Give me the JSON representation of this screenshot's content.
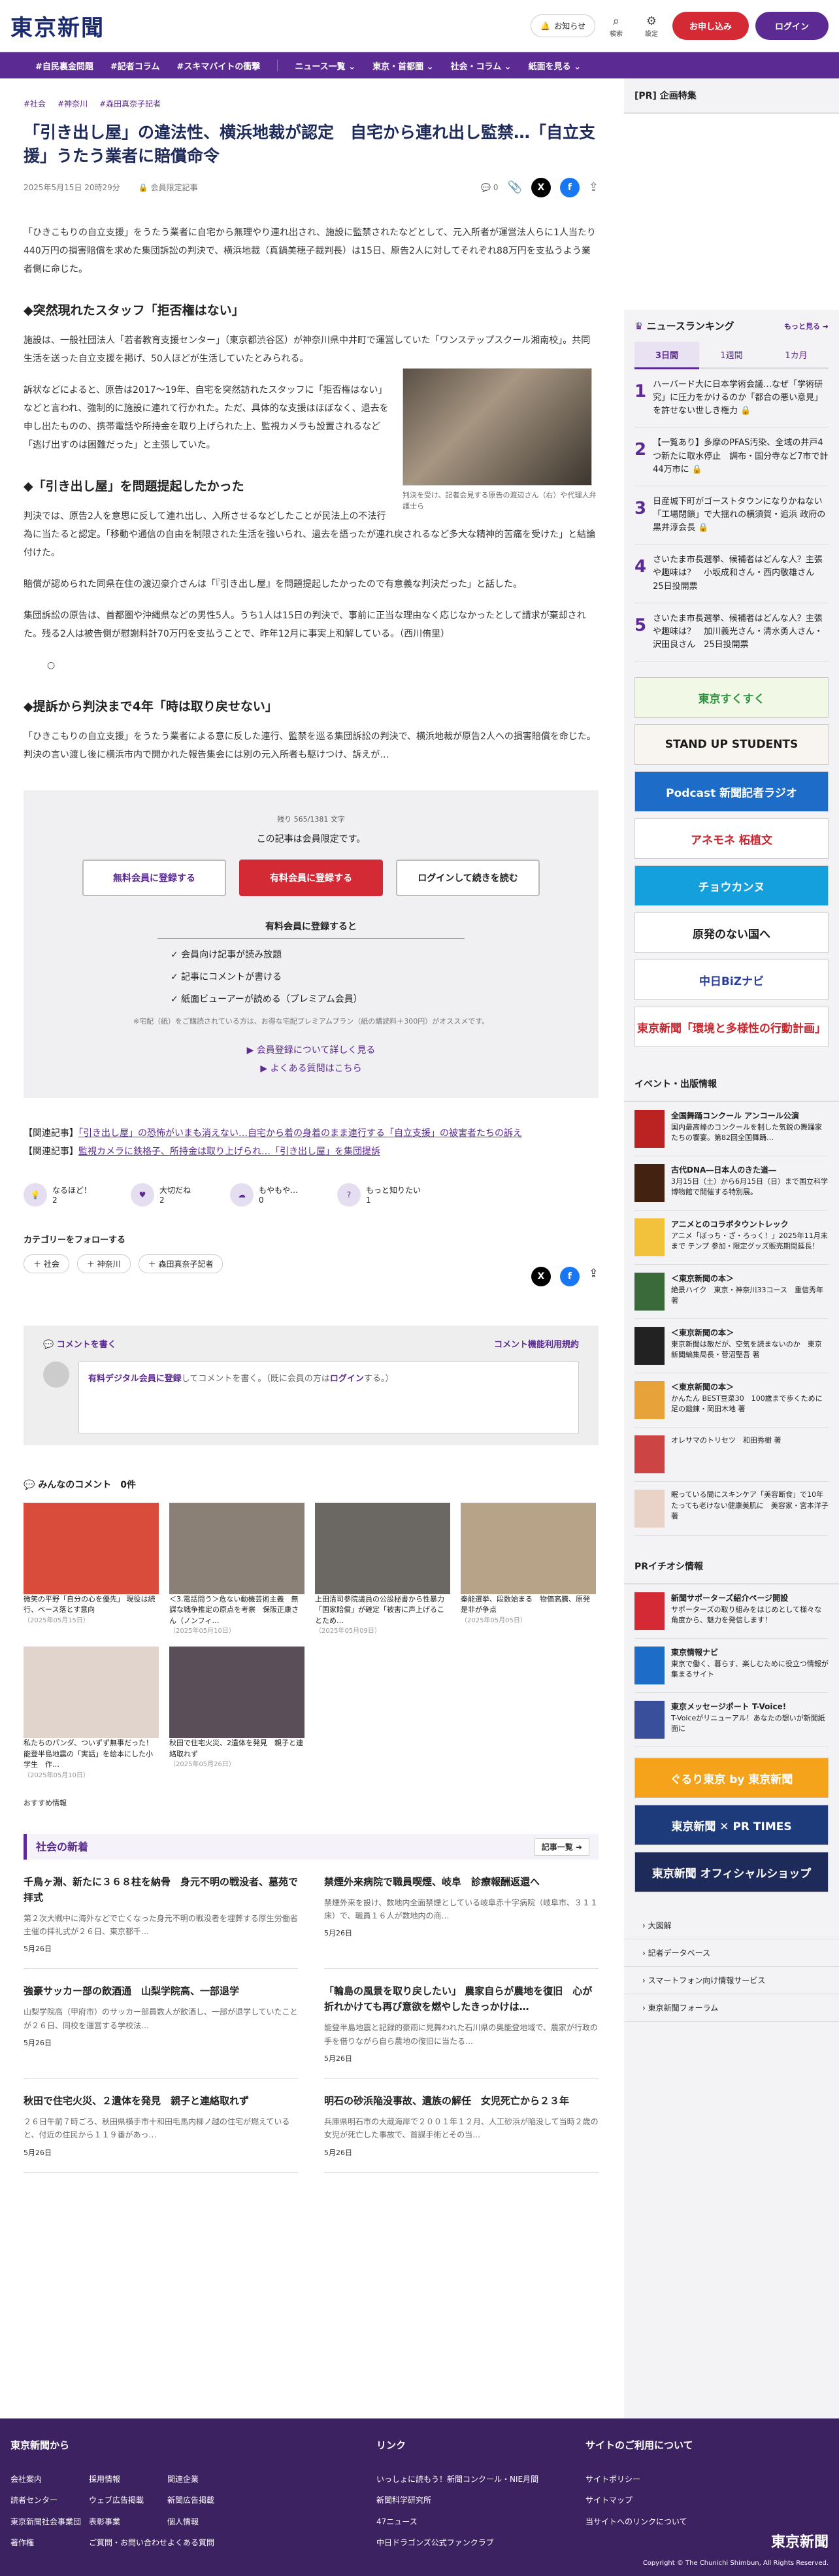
{
  "header": {
    "logo": "東京新聞",
    "notice": "お知らせ",
    "search": "検索",
    "settings": "設定",
    "register": "お申し込み",
    "login": "ログイン"
  },
  "nav": [
    "#自民裏金問題",
    "#記者コラム",
    "#スキマバイトの衝撃",
    "ニュース一覧 ⌄",
    "東京・首都圏 ⌄",
    "社会・コラム ⌄",
    "紙面を見る ⌄"
  ],
  "article": {
    "tags": [
      "#社会",
      "#神奈川",
      "#森田真奈子記者"
    ],
    "title": "「引き出し屋」の違法性、横浜地裁が認定　自宅から連れ出し監禁…「自立支援」うたう業者に賠償命令",
    "date": "2025年5月15日 20時29分",
    "member": "会員限定記事",
    "comment_count": "0",
    "p1": "「ひきこもりの自立支援」をうたう業者に自宅から無理やり連れ出され、施設に監禁されたなどとして、元入所者が運営法人らに1人当たり440万円の損害賠償を求めた集団訴訟の判決で、横浜地裁（真鍋美穂子裁判長）は15日、原告2人に対してそれぞれ88万円を支払うよう業者側に命じた。",
    "h1": "◆突然現れたスタッフ「拒否権はない」",
    "p2": "施設は、一般社団法人「若者教育支援センター」（東京都渋谷区）が神奈川県中井町で運営していた「ワンステップスクール湘南校」。共同生活を送った自立支援を掲げ、50人ほどが生活していたとみられる。",
    "p3": "訴状などによると、原告は2017～19年、自宅を突然訪れたスタッフに「拒否権はない」などと言われ、強制的に施設に連れて行かれた。ただ、具体的な支援はほぼなく、退去を申し出たものの、携帯電話や所持金を取り上げられた上、監視カメラも設置されるなど「逃げ出すのは困難だった」と主張していた。",
    "caption": "判決を受け、記者会見する原告の渡辺さん（右）や代理人弁護士ら",
    "h2": "◆「引き出し屋」を問題提起したかった",
    "p4": "判決では、原告2人を意思に反して連れ出し、入所させるなどしたことが民法上の不法行為に当たると認定。「移動や通信の自由を制限された生活を強いられ、過去を語ったが連れ戻されるなど多大な精神的苦痛を受けた」と結論付けた。",
    "p5": "賠償が認められた同県在住の渡辺豪介さんは「『引き出し屋』を問題提起したかったので有意義な判決だった」と話した。",
    "p6": "集団訴訟の原告は、首都圏や沖縄県などの男性5人。うち1人は15日の判決で、事前に正当な理由なく応じなかったとして請求が棄却された。残る2人は被告側が慰謝料計70万円を支払うことで、昨年12月に事実上和解している。（西川侑里）",
    "circle": "○",
    "h3": "◆提訴から判決まで4年「時は取り戻せない」",
    "p7": "「ひきこもりの自立支援」をうたう業者による意に反した連行、監禁を巡る集団訴訟の判決で、横浜地裁が原告2人への損害賠償を命じた。判決の言い渡し後に横浜市内で開かれた報告集会には別の元入所者も駆けつけ、訴えが…"
  },
  "paywall": {
    "remain": "残り 565/1381 文字",
    "msg": "この記事は会員限定です。",
    "free": "無料会員に登録する",
    "paid": "有料会員に登録する",
    "login": "ログインして続きを読む",
    "list_title": "有料会員に登録すると",
    "benefits": [
      "✓ 会員向け記事が読み放題",
      "✓ 記事にコメントが書ける",
      "✓ 紙面ビューアーが読める（プレミアム会員）"
    ],
    "note": "※宅配（紙）をご購読されている方は、お得な宅配プレミアムプラン（紙の購読料＋300円）がオススメです。",
    "link1": "▶ 会員登録について詳しく見る",
    "link2": "▶ よくある質問はこちら"
  },
  "related": {
    "label": "【関連記事】",
    "r1": "「引き出し屋」の恐怖がいまも消えない…自宅から着の身着のまま連行する「自立支援」の被害者たちの訴え",
    "r2": "監視カメラに鉄格子、所持金は取り上げられ…「引き出し屋」を集団提訴"
  },
  "reactions": [
    {
      "label": "なるほど！",
      "count": "2",
      "icon": "💡"
    },
    {
      "label": "大切だね",
      "count": "2",
      "icon": "♥"
    },
    {
      "label": "もやもや…",
      "count": "0",
      "icon": "☁"
    },
    {
      "label": "もっと知りたい",
      "count": "1",
      "icon": "?"
    }
  ],
  "follow": {
    "title": "カテゴリーをフォローする",
    "chips": [
      "＋ 社会",
      "＋ 神奈川",
      "＋ 森田真奈子記者"
    ]
  },
  "comment": {
    "write": "コメントを書く",
    "rules": "コメント機能利用規約",
    "placeholder_a": "有料デジタル会員に登録",
    "placeholder_b": "してコメントを書く。（既に会員の方は",
    "placeholder_c": "ログイン",
    "placeholder_d": "する。）",
    "all": "みんなのコメント　0件"
  },
  "cards": [
    {
      "t": "微笑の平野「自分の心を優先」 現役は続行、ベース落とす意向",
      "d": "（2025年05月15日）",
      "c": "#d94b3a"
    },
    {
      "t": "＜3.電話問う＞危ない動機芸術主義　無謀な戦争推定の原点を考察　保阪正康さん（ノンフィ…",
      "d": "（2025年05月10日）",
      "c": "#8a8076"
    },
    {
      "t": "上田清司参院議員の公設秘書から性暴力「国家賠償」が確定「被害に声上げることため…",
      "d": "（2025年05月09日）",
      "c": "#6b6762"
    },
    {
      "t": "秦能選挙、段数始まる　物価高騰、原発是非が争点",
      "d": "（2025年05月05日）",
      "c": "#b7a387"
    },
    {
      "t": "私たちのパンダ、ついずず無事だった！　能登半島地震の「実話」を絵本にした小学生　作…",
      "d": "（2025年05月10日）",
      "c": "#e0d4cc"
    },
    {
      "t": "秋田で住宅火災、2遺体を発見　親子と連絡取れず",
      "d": "（2025年05月26日）",
      "c": "#5a4e58"
    }
  ],
  "recommend": "おすすめ情報",
  "social": {
    "title": "社会の新着",
    "more": "記事一覧 ➜",
    "items": [
      {
        "h": "千鳥ヶ淵、新たに３６８柱を納骨　身元不明の戦没者、墓苑で拝式",
        "p": "第２次大戦中に海外などで亡くなった身元不明の戦没者を埋葬する厚生労働省主催の拝礼式が２６日、東京都千…",
        "d": "5月26日"
      },
      {
        "h": "禁煙外来病院で職員喫煙、岐阜　診療報酬返還へ",
        "p": "禁煙外来を設け、数地内全面禁煙としている岐阜赤十字病院（岐阜市、３１１床）で、職員１６人が数地内の商…",
        "d": "5月26日"
      },
      {
        "h": "強豪サッカー部の飲酒通　山梨学院高、一部退学",
        "p": "山梨学院高（甲府市）のサッカー部員数人が飲酒し、一部が退学していたことが２６日、同校を運営する学校法…",
        "d": "5月26日"
      },
      {
        "h": "「輪島の風景を取り戻したい」 農家自らが農地を復旧　心が折れかけても再び意欲を燃やしたきっかけは…",
        "p": "能登半島地震と記録的豪雨に見舞われた石川県の奥能登地域で、農家が行政の手を借りながら自ら農地の復旧に当たる…",
        "d": "5月26日"
      },
      {
        "h": "秋田で住宅火災、２遺体を発見　親子と連絡取れず",
        "p": "２６日午前７時ごろ、秋田県横手市十和田毛馬内柳ノ越の住宅が燃えていると、付近の住民から１１９番があっ…",
        "d": "5月26日"
      },
      {
        "h": "明石の砂浜陥没事故、遺族の解任　女児死亡から２３年",
        "p": "兵庫県明石市の大蔵海岸で２００１年１２月、人工砂浜が陥没して当時２歳の女児が死亡した事故で、首謀手術とその当…",
        "d": "5月26日"
      }
    ]
  },
  "side": {
    "pr": "[PR] 企画特集",
    "ranking": "ニュースランキング",
    "ranking_more": "もっと見る ➜",
    "tabs": [
      "3日間",
      "1週間",
      "1カ月"
    ],
    "ranks": [
      {
        "n": "1",
        "t": "ハーバード大に日本学術会議…なぜ「学術研究」に圧力をかけるのか「都合の悪い意見」を許せない世しき権力 🔒"
      },
      {
        "n": "2",
        "t": "【一覧あり】多摩のPFAS汚染、全域の井戸4つ新たに取水停止　調布・国分寺など7市で計44万市に 🔒"
      },
      {
        "n": "3",
        "t": "日産城下町がゴーストタウンになりかねない「工場閉鎖」で大揺れの横須賀・追浜 政府の黒井淳会長 🔒"
      },
      {
        "n": "4",
        "t": "さいたま市長選挙、候補者はどんな人？主張や趣味は？　小坂成和さん・西内敬雄さん　25日投開票"
      },
      {
        "n": "5",
        "t": "さいたま市長選挙、候補者はどんな人？主張や趣味は？　加川義光さん・清水勇人さん・沢田良さん　25日投開票"
      }
    ],
    "banners": [
      {
        "t": "東京すくすく",
        "bg": "#f1f8e6",
        "fg": "#2f9440"
      },
      {
        "t": "STAND UP STUDENTS",
        "bg": "#f8f4ef",
        "fg": "#1a1a1a"
      },
      {
        "t": "Podcast 新聞記者ラジオ",
        "bg": "#1d6cc7",
        "fg": "#fff"
      },
      {
        "t": "アネモネ 柘植文",
        "bg": "#fff",
        "fg": "#c7262e"
      },
      {
        "t": "チョウカンヌ",
        "bg": "#14a0dc",
        "fg": "#fff"
      },
      {
        "t": "原発のない国へ",
        "bg": "#fff",
        "fg": "#1a1a1a"
      },
      {
        "t": "中日BiZナビ",
        "bg": "#fff",
        "fg": "#2a3f9c"
      },
      {
        "t": "東京新聞「環境と多様性の行動計画」",
        "bg": "#fff",
        "fg": "#c7262e"
      }
    ],
    "events_title": "イベント・出版情報",
    "events": [
      {
        "b": "全国舞踊コンクール アンコール公演",
        "s": "国内最高峰のコンクールを制した気鋭の舞踊家たちの饗宴。第82回全国舞踊…",
        "c": "#b22"
      },
      {
        "b": "古代DNA―日本人のきた道―",
        "s": "3月15日（土）から6月15日（日）まで国立科学博物館で開催する特別展。",
        "c": "#421"
      },
      {
        "b": "アニメとのコラボタウントレック",
        "s": "アニメ「ぼっち・ざ・ろっく！」2025年11月末まで テンプ 参加・限定グッズ販売期間延長！",
        "c": "#f2c23c"
      },
      {
        "b": "＜東京新聞の本＞",
        "s": "絶景ハイク　東京・神奈川33コース　重信秀年 著",
        "c": "#3a6a3a"
      },
      {
        "b": "＜東京新聞の本＞",
        "s": "東京新聞は敵だが、空気を読まないのか　東京新聞編集局長・菅沼堅吾 著",
        "c": "#222"
      },
      {
        "b": "＜東京新聞の本＞",
        "s": "かんたん BEST豆菜30　100歳まで歩くために　足の鍛錬・岡田木地 著",
        "c": "#e8a23a"
      }
    ],
    "ev_tail1": "オレサマのトリセツ　和田秀樹 著",
    "ev_tail2": "眠っている間にスキンケア「美容断食」で10年たっても老けない健康美肌に　美容家・宮本洋子 著",
    "pr_info": "PRイチオシ情報",
    "pr_items": [
      {
        "b": "新聞サポーターズ紹介ページ開設",
        "s": "サポーターズの取り組みをはじめとして様々な角度から、魅力を発信します！",
        "c": "#d42a36"
      },
      {
        "b": "東京情報ナビ",
        "s": "東京で働く、暮らす、楽しむために役立つ情報が集まるサイト",
        "c": "#1d6cc7"
      },
      {
        "b": "東京メッセージポート T-Voice!",
        "s": "T-Voiceがリニューアル！あなたの想いが新聞紙面に",
        "c": "#3a4f9c"
      }
    ],
    "pr_banners": [
      {
        "t": "ぐるり東京 by 東京新聞",
        "bg": "#f4a31a",
        "fg": "#fff"
      },
      {
        "t": "東京新聞 ✕ PR TIMES",
        "bg": "#1d3a7a",
        "fg": "#fff"
      },
      {
        "t": "東京新聞 オフィシャルショップ",
        "bg": "#1d2a5a",
        "fg": "#fff"
      }
    ],
    "links": [
      "› 大図解",
      "› 記者データベース",
      "› スマートフォン向け情報サービス",
      "› 東京新聞フォーラム"
    ]
  },
  "footer": {
    "c1": "東京新聞から",
    "c1_rows": [
      "会社案内",
      "採用情報",
      "関連企業",
      "読者センター",
      "ウェブ広告掲載",
      "新聞広告掲載",
      "東京新聞社会事業団",
      "表彰事業",
      "個人情報",
      "著作権",
      "ご質問・お問い合わせ",
      "よくある質問"
    ],
    "c2": "リンク",
    "c2_rows": [
      "いっしょに読もう！新聞コンクール・NIE月間",
      "新聞科学研究所",
      "47ニュース",
      "中日ドラゴンズ公式ファンクラブ"
    ],
    "c3": "サイトのご利用について",
    "c3_rows": [
      "サイトポリシー",
      "サイトマップ",
      "当サイトへのリンクについて"
    ],
    "logo": "東京新聞",
    "copy": "Copyright © The Chunichi Shimbun, All Rights Reserved."
  }
}
